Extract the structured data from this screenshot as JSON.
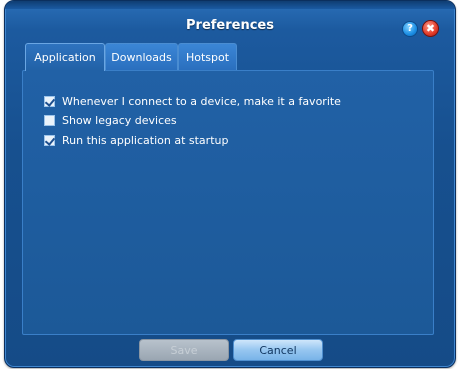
{
  "window": {
    "title": "Preferences",
    "help_label": "?",
    "close_label": "✖"
  },
  "tabs": [
    {
      "label": "Application",
      "active": true
    },
    {
      "label": "Downloads",
      "active": false
    },
    {
      "label": "Hotspot",
      "active": false
    }
  ],
  "options": [
    {
      "label": "Whenever I connect to a device, make it a favorite",
      "checked": true
    },
    {
      "label": "Show legacy devices",
      "checked": false
    },
    {
      "label": "Run this application at startup",
      "checked": true
    }
  ],
  "buttons": {
    "save_label": "Save",
    "save_disabled": true,
    "cancel_label": "Cancel"
  }
}
